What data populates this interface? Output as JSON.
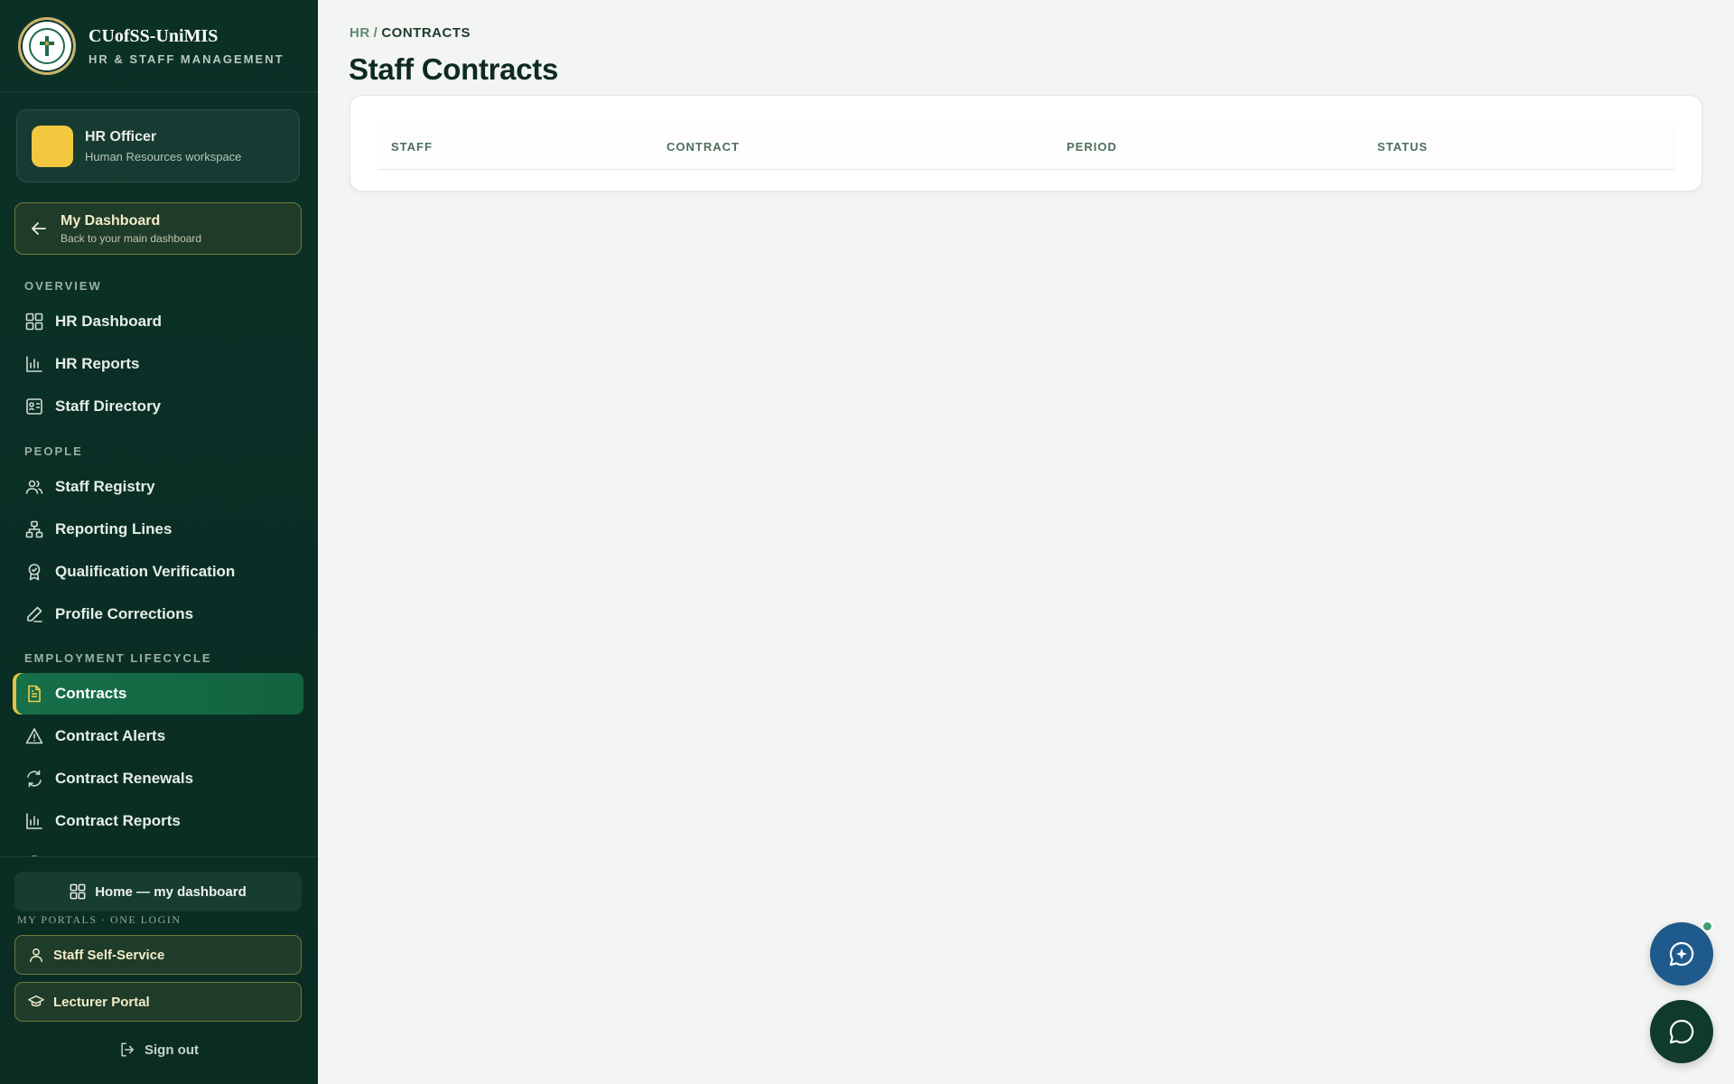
{
  "brand": {
    "name": "CUofSS-UniMIS",
    "subtitle": "HR & STAFF MANAGEMENT"
  },
  "user": {
    "role": "HR Officer",
    "workspace": "Human Resources workspace"
  },
  "dashboard_button": {
    "title": "My Dashboard",
    "subtitle": "Back to your main dashboard"
  },
  "sections": {
    "overview": "OVERVIEW",
    "people": "PEOPLE",
    "employment": "EMPLOYMENT LIFECYCLE"
  },
  "nav": {
    "hr_dashboard": "HR Dashboard",
    "hr_reports": "HR Reports",
    "staff_directory": "Staff Directory",
    "staff_registry": "Staff Registry",
    "reporting_lines": "Reporting Lines",
    "qualification_verification": "Qualification Verification",
    "profile_corrections": "Profile Corrections",
    "contracts": "Contracts",
    "contract_alerts": "Contract Alerts",
    "contract_renewals": "Contract Renewals",
    "contract_reports": "Contract Reports"
  },
  "bottom": {
    "home": "Home — my dashboard",
    "portals_label": "MY PORTALS · ONE LOGIN",
    "staff_self_service": "Staff Self-Service",
    "lecturer_portal": "Lecturer Portal",
    "sign_out": "Sign out"
  },
  "breadcrumb": {
    "root": "HR",
    "separator": "/",
    "current": "CONTRACTS"
  },
  "page_title": "Staff Contracts",
  "table": {
    "columns": [
      "STAFF",
      "CONTRACT",
      "PERIOD",
      "STATUS"
    ]
  },
  "colors": {
    "sidebar_bg": "#0b3127",
    "active_item": "#16704a",
    "accent_gold": "#e5c343",
    "ai_fab": "#1f5a8c",
    "chat_fab": "#0f3a2c",
    "online_dot": "#3fa071"
  },
  "icons": {
    "ai_fab": "ai-chat-sparkle-icon",
    "chat_fab": "chat-bubble-icon"
  }
}
